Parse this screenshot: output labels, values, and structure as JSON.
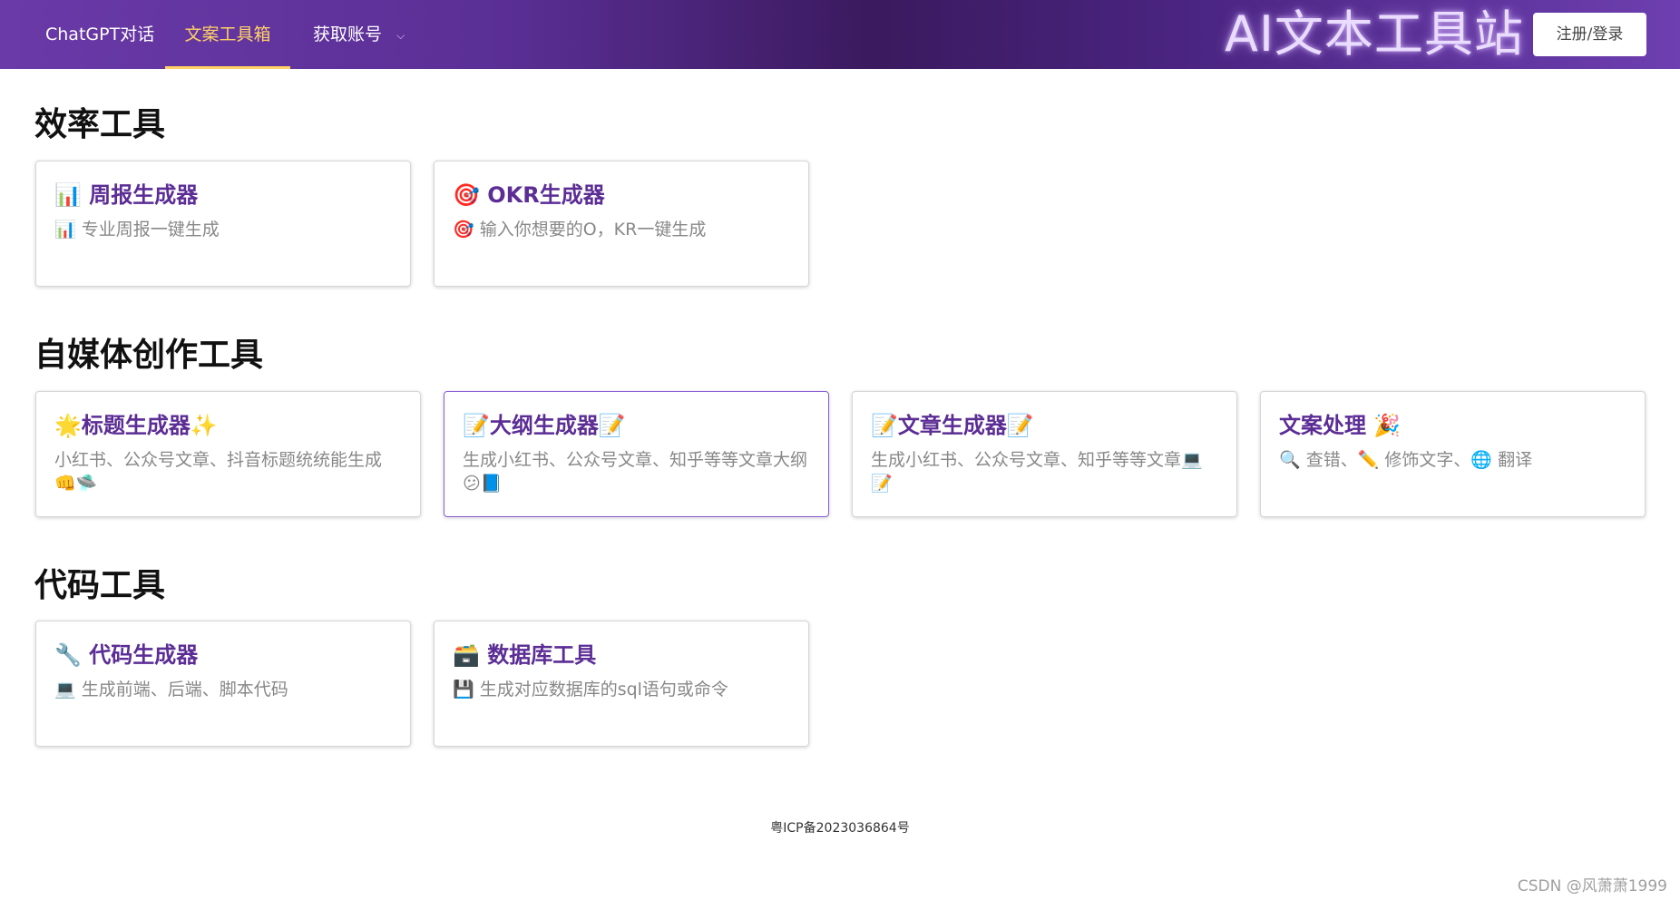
{
  "nav": {
    "chat_label": "ChatGPT对话",
    "tools_label": "文案工具箱",
    "account_label": "获取账号",
    "account_chevron": "⌵"
  },
  "brand": {
    "title": "AI文本工具站"
  },
  "header": {
    "login_label": "注册/登录"
  },
  "sections": [
    {
      "title": "效率工具",
      "cards": [
        {
          "title": "📊 周报生成器",
          "desc": "📊 专业周报一键生成"
        },
        {
          "title": "🎯 OKR生成器",
          "desc": "🎯 输入你想要的O，KR一键生成"
        }
      ]
    },
    {
      "title": "自媒体创作工具",
      "cards": [
        {
          "title": "🌟标题生成器✨",
          "desc": "小红书、公众号文章、抖音标题统统能生成👊🛸"
        },
        {
          "title": "📝大纲生成器📝",
          "desc": "生成小红书、公众号文章、知乎等等文章大纲😕📘"
        },
        {
          "title": "📝文章生成器📝",
          "desc": "生成小红书、公众号文章、知乎等等文章💻📝"
        },
        {
          "title": "文案处理 🎉",
          "desc": "🔍 查错、✏️ 修饰文字、🌐 翻译"
        }
      ]
    },
    {
      "title": "代码工具",
      "cards": [
        {
          "title": "🔧 代码生成器",
          "desc": "💻 生成前端、后端、脚本代码"
        },
        {
          "title": "🗃️ 数据库工具",
          "desc": "💾 生成对应数据库的sql语句或命令"
        }
      ]
    }
  ],
  "footer": {
    "icp": "粤ICP备2023036864号"
  },
  "watermark": "CSDN @风萧萧1999",
  "colors": {
    "header_gradient_start": "#6a3aa8",
    "header_gradient_mid": "#3b1a5e",
    "active_nav": "#ffd166",
    "card_title": "#5b2d95"
  }
}
